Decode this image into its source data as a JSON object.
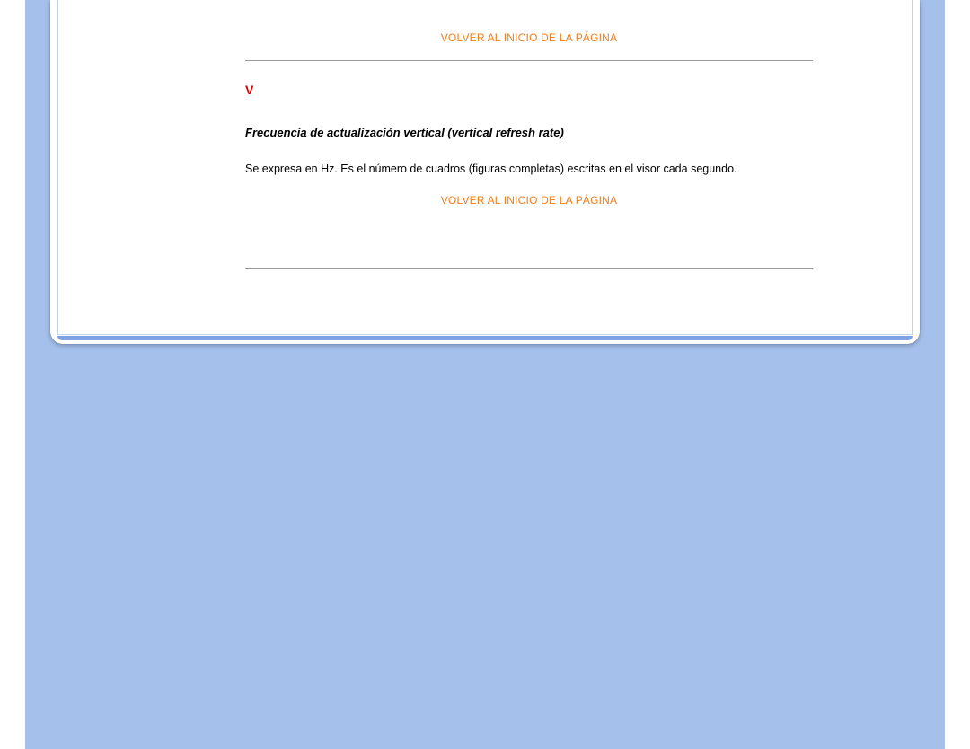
{
  "links": {
    "back_to_top": "VOLVER AL INICIO DE LA PÁGINA"
  },
  "section": {
    "letter": "V",
    "term_title": "Frecuencia de actualización vertical (vertical refresh rate)",
    "term_description": "Se expresa en Hz. Es el número de cuadros (figuras completas) escritas en el visor cada segundo."
  }
}
